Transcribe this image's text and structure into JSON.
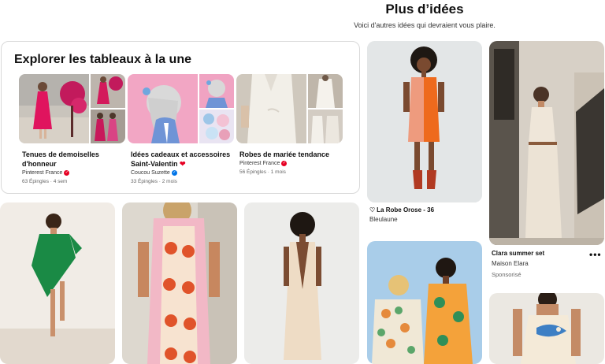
{
  "header": {
    "title": "Plus d’idées",
    "subtitle": "Voici d'autres idées qui devraient vous plaire."
  },
  "boards_section": {
    "title": "Explorer les tableaux à la une",
    "boards": [
      {
        "name": "Tenues de demoiselles d'honneur",
        "owner": "Pinterest France",
        "meta": "63 Épingles · 4 sem",
        "badge_color": "#e60023",
        "icon": "verified-badge-icon"
      },
      {
        "name": "Idées cadeaux et accessoires Saint-Valentin",
        "name_emoji": "❤",
        "owner": "Coucou Suzette",
        "meta": "33 Épingles · 2 mois",
        "badge_color": "#0074e8",
        "icon": "verified-badge-icon"
      },
      {
        "name": "Robes de mariée tendance",
        "owner": "Pinterest France",
        "meta": "56 Épingles · 1 mois",
        "badge_color": "#e60023",
        "icon": "verified-badge-icon"
      }
    ]
  },
  "pins": {
    "orange_dress": {
      "title": "La Robe Orose - 36",
      "subtitle": "Bleulaune",
      "icon": "heart-outline-icon"
    },
    "clara": {
      "title": "Clara summer set",
      "subtitle": "Maison Elara",
      "sponsored": "Sponsorisé",
      "more_label": "•••"
    }
  },
  "colors": {
    "accent_red": "#e60023",
    "verified_blue": "#0074e8",
    "card_border": "#d9d9d9"
  }
}
